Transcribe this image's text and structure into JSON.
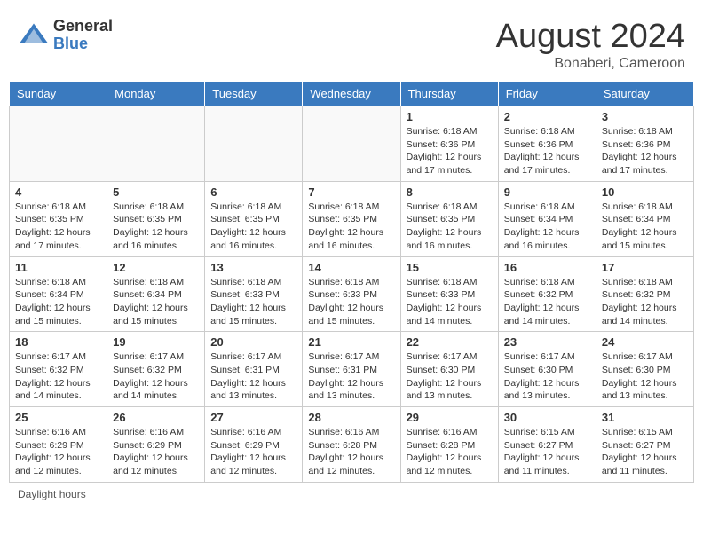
{
  "header": {
    "logo_general": "General",
    "logo_blue": "Blue",
    "month_title": "August 2024",
    "location": "Bonaberi, Cameroon"
  },
  "days_of_week": [
    "Sunday",
    "Monday",
    "Tuesday",
    "Wednesday",
    "Thursday",
    "Friday",
    "Saturday"
  ],
  "footer": {
    "daylight_note": "Daylight hours"
  },
  "weeks": [
    {
      "days": [
        {
          "number": "",
          "info": ""
        },
        {
          "number": "",
          "info": ""
        },
        {
          "number": "",
          "info": ""
        },
        {
          "number": "",
          "info": ""
        },
        {
          "number": "1",
          "info": "Sunrise: 6:18 AM\nSunset: 6:36 PM\nDaylight: 12 hours\nand 17 minutes."
        },
        {
          "number": "2",
          "info": "Sunrise: 6:18 AM\nSunset: 6:36 PM\nDaylight: 12 hours\nand 17 minutes."
        },
        {
          "number": "3",
          "info": "Sunrise: 6:18 AM\nSunset: 6:36 PM\nDaylight: 12 hours\nand 17 minutes."
        }
      ]
    },
    {
      "days": [
        {
          "number": "4",
          "info": "Sunrise: 6:18 AM\nSunset: 6:35 PM\nDaylight: 12 hours\nand 17 minutes."
        },
        {
          "number": "5",
          "info": "Sunrise: 6:18 AM\nSunset: 6:35 PM\nDaylight: 12 hours\nand 16 minutes."
        },
        {
          "number": "6",
          "info": "Sunrise: 6:18 AM\nSunset: 6:35 PM\nDaylight: 12 hours\nand 16 minutes."
        },
        {
          "number": "7",
          "info": "Sunrise: 6:18 AM\nSunset: 6:35 PM\nDaylight: 12 hours\nand 16 minutes."
        },
        {
          "number": "8",
          "info": "Sunrise: 6:18 AM\nSunset: 6:35 PM\nDaylight: 12 hours\nand 16 minutes."
        },
        {
          "number": "9",
          "info": "Sunrise: 6:18 AM\nSunset: 6:34 PM\nDaylight: 12 hours\nand 16 minutes."
        },
        {
          "number": "10",
          "info": "Sunrise: 6:18 AM\nSunset: 6:34 PM\nDaylight: 12 hours\nand 15 minutes."
        }
      ]
    },
    {
      "days": [
        {
          "number": "11",
          "info": "Sunrise: 6:18 AM\nSunset: 6:34 PM\nDaylight: 12 hours\nand 15 minutes."
        },
        {
          "number": "12",
          "info": "Sunrise: 6:18 AM\nSunset: 6:34 PM\nDaylight: 12 hours\nand 15 minutes."
        },
        {
          "number": "13",
          "info": "Sunrise: 6:18 AM\nSunset: 6:33 PM\nDaylight: 12 hours\nand 15 minutes."
        },
        {
          "number": "14",
          "info": "Sunrise: 6:18 AM\nSunset: 6:33 PM\nDaylight: 12 hours\nand 15 minutes."
        },
        {
          "number": "15",
          "info": "Sunrise: 6:18 AM\nSunset: 6:33 PM\nDaylight: 12 hours\nand 14 minutes."
        },
        {
          "number": "16",
          "info": "Sunrise: 6:18 AM\nSunset: 6:32 PM\nDaylight: 12 hours\nand 14 minutes."
        },
        {
          "number": "17",
          "info": "Sunrise: 6:18 AM\nSunset: 6:32 PM\nDaylight: 12 hours\nand 14 minutes."
        }
      ]
    },
    {
      "days": [
        {
          "number": "18",
          "info": "Sunrise: 6:17 AM\nSunset: 6:32 PM\nDaylight: 12 hours\nand 14 minutes."
        },
        {
          "number": "19",
          "info": "Sunrise: 6:17 AM\nSunset: 6:32 PM\nDaylight: 12 hours\nand 14 minutes."
        },
        {
          "number": "20",
          "info": "Sunrise: 6:17 AM\nSunset: 6:31 PM\nDaylight: 12 hours\nand 13 minutes."
        },
        {
          "number": "21",
          "info": "Sunrise: 6:17 AM\nSunset: 6:31 PM\nDaylight: 12 hours\nand 13 minutes."
        },
        {
          "number": "22",
          "info": "Sunrise: 6:17 AM\nSunset: 6:30 PM\nDaylight: 12 hours\nand 13 minutes."
        },
        {
          "number": "23",
          "info": "Sunrise: 6:17 AM\nSunset: 6:30 PM\nDaylight: 12 hours\nand 13 minutes."
        },
        {
          "number": "24",
          "info": "Sunrise: 6:17 AM\nSunset: 6:30 PM\nDaylight: 12 hours\nand 13 minutes."
        }
      ]
    },
    {
      "days": [
        {
          "number": "25",
          "info": "Sunrise: 6:16 AM\nSunset: 6:29 PM\nDaylight: 12 hours\nand 12 minutes."
        },
        {
          "number": "26",
          "info": "Sunrise: 6:16 AM\nSunset: 6:29 PM\nDaylight: 12 hours\nand 12 minutes."
        },
        {
          "number": "27",
          "info": "Sunrise: 6:16 AM\nSunset: 6:29 PM\nDaylight: 12 hours\nand 12 minutes."
        },
        {
          "number": "28",
          "info": "Sunrise: 6:16 AM\nSunset: 6:28 PM\nDaylight: 12 hours\nand 12 minutes."
        },
        {
          "number": "29",
          "info": "Sunrise: 6:16 AM\nSunset: 6:28 PM\nDaylight: 12 hours\nand 12 minutes."
        },
        {
          "number": "30",
          "info": "Sunrise: 6:15 AM\nSunset: 6:27 PM\nDaylight: 12 hours\nand 11 minutes."
        },
        {
          "number": "31",
          "info": "Sunrise: 6:15 AM\nSunset: 6:27 PM\nDaylight: 12 hours\nand 11 minutes."
        }
      ]
    }
  ]
}
